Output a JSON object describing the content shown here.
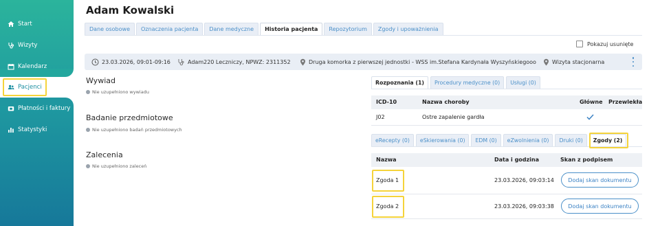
{
  "sidebar": {
    "items": [
      {
        "label": "Start",
        "icon": "home-icon"
      },
      {
        "label": "Wizyty",
        "icon": "stethoscope-icon"
      },
      {
        "label": "Kalendarz",
        "icon": "calendar-icon"
      },
      {
        "label": "Pacjenci",
        "icon": "users-icon",
        "active": true
      },
      {
        "label": "Płatności i faktury",
        "icon": "wallet-icon"
      },
      {
        "label": "Statystyki",
        "icon": "bar-chart-icon"
      }
    ],
    "accent_color": "#f5d33a"
  },
  "header": {
    "patient_name": "Adam Kowalski",
    "tabs": [
      {
        "label": "Dane osobowe"
      },
      {
        "label": "Oznaczenia pacjenta"
      },
      {
        "label": "Dane medyczne"
      },
      {
        "label": "Historia pacjenta",
        "active": true
      },
      {
        "label": "Repozytorium"
      },
      {
        "label": "Zgody i upoważnienia"
      }
    ]
  },
  "show_deleted": {
    "label": "Pokazuj usunięte",
    "checked": false
  },
  "visit_info": {
    "datetime": "23.03.2026, 09:01-09:16",
    "doctor": "Adam220 Leczniczy, NPWZ: 2311352",
    "location": "Druga komorka z pierwszej jednostki - WSS im.Stefana Kardynała Wyszyńskiegooo",
    "visit_type": "Wizyta stacjonarna"
  },
  "sections": {
    "wywiad": {
      "title": "Wywiad",
      "note": "Nie uzupełniono wywiadu"
    },
    "badanie": {
      "title": "Badanie przedmiotowe",
      "note": "Nie uzupełniono badań przedmiotowych"
    },
    "zalecenia": {
      "title": "Zalecenia",
      "note": "Nie uzupełniono zaleceń"
    }
  },
  "diagnosis_tabs": [
    {
      "label": "Rozpoznania (1)",
      "active": true
    },
    {
      "label": "Procedury medyczne (0)"
    },
    {
      "label": "Usługi (0)"
    }
  ],
  "diagnosis_table": {
    "columns": [
      "ICD-10",
      "Nazwa choroby",
      "Główne",
      "Przewlekła"
    ],
    "rows": [
      {
        "icd": "J02",
        "name": "Ostre zapalenie gardła",
        "main": true,
        "chronic": false
      }
    ]
  },
  "document_tabs": [
    {
      "label": "eRecepty (0)"
    },
    {
      "label": "eSkierowania (0)"
    },
    {
      "label": "EDM (0)"
    },
    {
      "label": "eZwolnienia (0)"
    },
    {
      "label": "Druki (0)"
    },
    {
      "label": "Zgody (2)",
      "active": true
    }
  ],
  "consents_table": {
    "columns": [
      "Nazwa",
      "Data i godzina",
      "Skan z podpisem"
    ],
    "rows": [
      {
        "name": "Zgoda 1",
        "datetime": "23.03.2026, 09:03:14",
        "action": "Dodaj skan dokumentu"
      },
      {
        "name": "Zgoda 2",
        "datetime": "23.03.2026, 09:03:38",
        "action": "Dodaj skan dokumentu"
      }
    ]
  }
}
